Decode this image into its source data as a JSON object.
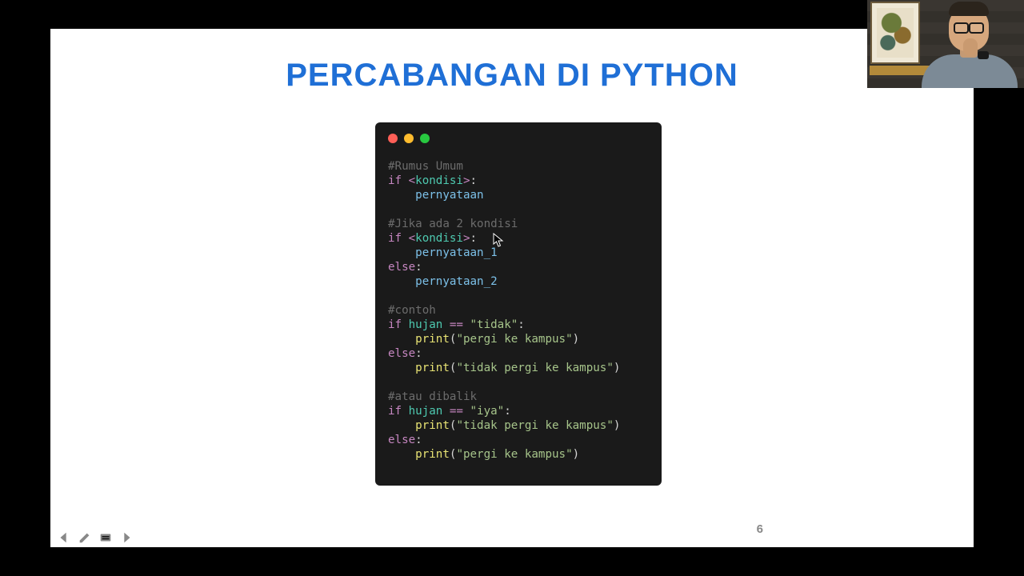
{
  "slide": {
    "title": "PERCABANGAN DI PYTHON",
    "page_number": "6"
  },
  "code": {
    "sections": [
      {
        "comment": "#Rumus Umum",
        "lines": [
          {
            "raw": "if <kondisi>:",
            "tokens": [
              [
                "kw",
                "if "
              ],
              [
                "angle",
                "<"
              ],
              [
                "ident",
                "kondisi"
              ],
              [
                "angle",
                ">"
              ],
              [
                "punct",
                ":"
              ]
            ]
          },
          {
            "raw": "    pernyataan",
            "tokens": [
              [
                "punct",
                "    "
              ],
              [
                "stmt",
                "pernyataan"
              ]
            ]
          }
        ]
      },
      {
        "comment": "#Jika ada 2 kondisi",
        "lines": [
          {
            "raw": "if <kondisi>:",
            "tokens": [
              [
                "kw",
                "if "
              ],
              [
                "angle",
                "<"
              ],
              [
                "ident",
                "kondisi"
              ],
              [
                "angle",
                ">"
              ],
              [
                "punct",
                ":"
              ]
            ]
          },
          {
            "raw": "    pernyataan_1",
            "tokens": [
              [
                "punct",
                "    "
              ],
              [
                "stmt",
                "pernyataan_1"
              ]
            ]
          },
          {
            "raw": "else:",
            "tokens": [
              [
                "kw",
                "else"
              ],
              [
                "punct",
                ":"
              ]
            ]
          },
          {
            "raw": "    pernyataan_2",
            "tokens": [
              [
                "punct",
                "    "
              ],
              [
                "stmt",
                "pernyataan_2"
              ]
            ]
          }
        ]
      },
      {
        "comment": "#contoh",
        "lines": [
          {
            "raw": "if hujan == \"tidak\":",
            "tokens": [
              [
                "kw",
                "if "
              ],
              [
                "ident",
                "hujan "
              ],
              [
                "op",
                "== "
              ],
              [
                "str",
                "\"tidak\""
              ],
              [
                "punct",
                ":"
              ]
            ]
          },
          {
            "raw": "    print(\"pergi ke kampus\")",
            "tokens": [
              [
                "punct",
                "    "
              ],
              [
                "func",
                "print"
              ],
              [
                "punct",
                "("
              ],
              [
                "str",
                "\"pergi ke kampus\""
              ],
              [
                "punct",
                ")"
              ]
            ]
          },
          {
            "raw": "else:",
            "tokens": [
              [
                "kw",
                "else"
              ],
              [
                "punct",
                ":"
              ]
            ]
          },
          {
            "raw": "    print(\"tidak pergi ke kampus\")",
            "tokens": [
              [
                "punct",
                "    "
              ],
              [
                "func",
                "print"
              ],
              [
                "punct",
                "("
              ],
              [
                "str",
                "\"tidak pergi ke kampus\""
              ],
              [
                "punct",
                ")"
              ]
            ]
          }
        ]
      },
      {
        "comment": "#atau dibalik",
        "lines": [
          {
            "raw": "if hujan == \"iya\":",
            "tokens": [
              [
                "kw",
                "if "
              ],
              [
                "ident",
                "hujan "
              ],
              [
                "op",
                "== "
              ],
              [
                "str",
                "\"iya\""
              ],
              [
                "punct",
                ":"
              ]
            ]
          },
          {
            "raw": "    print(\"tidak pergi ke kampus\")",
            "tokens": [
              [
                "punct",
                "    "
              ],
              [
                "func",
                "print"
              ],
              [
                "punct",
                "("
              ],
              [
                "str",
                "\"tidak pergi ke kampus\""
              ],
              [
                "punct",
                ")"
              ]
            ]
          },
          {
            "raw": "else:",
            "tokens": [
              [
                "kw",
                "else"
              ],
              [
                "punct",
                ":"
              ]
            ]
          },
          {
            "raw": "    print(\"pergi ke kampus\")",
            "tokens": [
              [
                "punct",
                "    "
              ],
              [
                "func",
                "print"
              ],
              [
                "punct",
                "("
              ],
              [
                "str",
                "\"pergi ke kampus\""
              ],
              [
                "punct",
                ")"
              ]
            ]
          }
        ]
      }
    ]
  },
  "nav": {
    "prev": "previous-slide",
    "pen": "annotate",
    "menu": "slide-menu",
    "next": "next-slide"
  }
}
